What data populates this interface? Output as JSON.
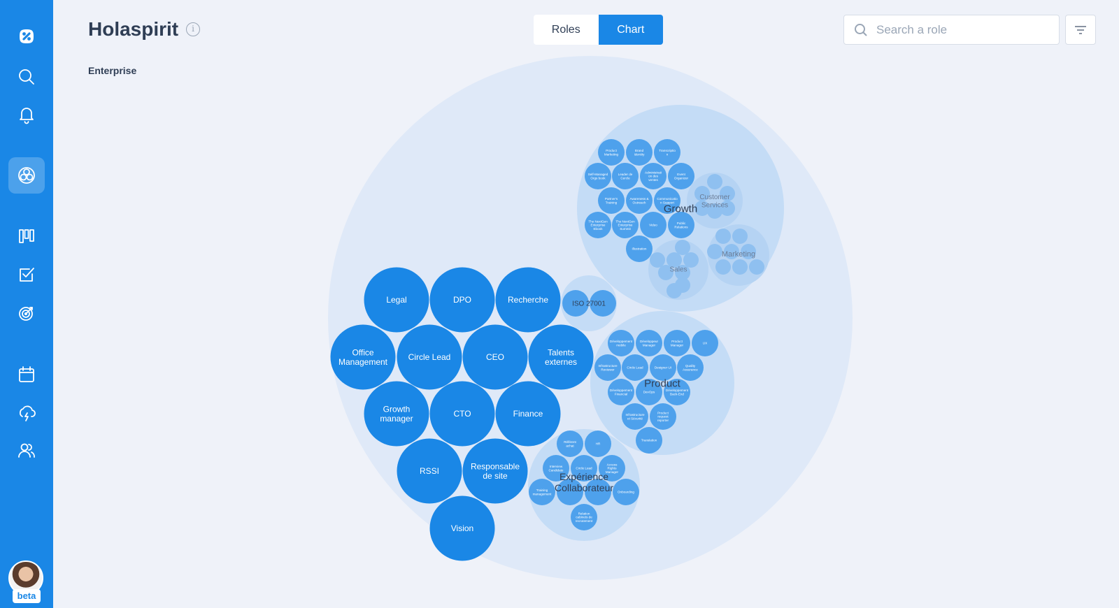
{
  "app": {
    "title": "Holaspirit",
    "breadcrumb": "Enterprise"
  },
  "view_toggle": {
    "roles_label": "Roles",
    "chart_label": "Chart",
    "active": "Chart"
  },
  "search": {
    "placeholder": "Search a role",
    "value": ""
  },
  "sidebar": {
    "items": [
      {
        "name": "logo-icon"
      },
      {
        "name": "search-icon"
      },
      {
        "name": "bell-icon"
      },
      {
        "name": "organization-icon",
        "active": true
      },
      {
        "name": "board-icon"
      },
      {
        "name": "checklist-icon"
      },
      {
        "name": "target-icon"
      },
      {
        "name": "calendar-icon"
      },
      {
        "name": "meeting-icon"
      },
      {
        "name": "people-icon"
      }
    ],
    "beta_label": "beta"
  },
  "colors": {
    "accent": "#1a87e6",
    "sidebar": "#1a87e6",
    "background": "#eff2f9",
    "outer_circle": "#dfe9f8",
    "sub_circle": "#c4dcf6",
    "role_circle": "#1a87e6",
    "small_role": "#4ea1ec"
  },
  "chart": {
    "roles": [
      "Legal",
      "DPO",
      "Recherche",
      "Office Management",
      "Circle Lead",
      "CEO",
      "Talents externes",
      "Growth manager",
      "CTO",
      "Finance",
      "RSSI",
      "Responsable de site",
      "Vision"
    ],
    "circles": {
      "growth": {
        "label": "Growth",
        "roles": [
          "Product Marketing",
          "Brand Identity",
          "Transcriptio n",
          "Self-Managed Orgs book",
          "Leader de Cercle",
          "Administrati on des ventes",
          "Event Organizer",
          "Partner's Training",
          "Awareness & Outreach",
          "Communicatio n Support",
          "The NextGen Enterprise Ebook",
          "The NextGen Enterprise Summit",
          "Video",
          "Public Relations",
          "Illustration"
        ],
        "sub_circles": [
          "Customer Services",
          "Marketing",
          "Sales"
        ]
      },
      "iso": {
        "label": "ISO 27001"
      },
      "product": {
        "label": "Product",
        "roles": [
          "Développement mobile",
          "Développeur Manager",
          "Product Manager",
          "UX",
          "Infrastructure Reviewer",
          "Circle Lead",
          "Designer UI",
          "Quality Assurance",
          "Développement Financial",
          "DevOps",
          "Développement Back-End",
          "Infrastructure et Sécurité",
          "Product request reporter",
          "Translation"
        ]
      },
      "experience": {
        "label": "Expérience Collaborateur",
        "roles": [
          "Référent achat",
          "HR",
          "Interview Candidate",
          "Circle Lead",
          "Access Rights Manager",
          "Training management",
          "Onboarding",
          "Relation cabinets de recrutement"
        ]
      }
    }
  }
}
